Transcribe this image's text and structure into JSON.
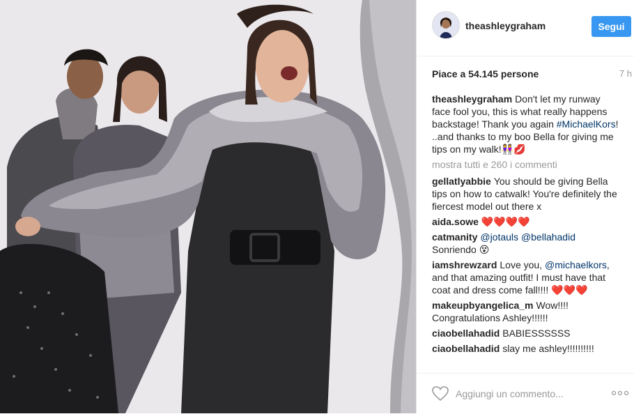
{
  "post": {
    "username": "theashleygraham",
    "follow_label": "Segui",
    "likes": "Piace a 54.145 persone",
    "time": "7 h",
    "caption": {
      "username": "theashleygraham",
      "text_1": "Don't let my runway face fool you, this is what really happens backstage! Thank you again ",
      "hashtag": "#MichaelKors",
      "text_2": "! ..and thanks to my boo Bella for giving me tips on my walk!",
      "emoji": "👭💋"
    },
    "show_all": "mostra tutti e 260 i commenti",
    "add_comment_placeholder": "Aggiungi un commento..."
  },
  "comments": [
    {
      "username": "gellatlyabbie",
      "text": "You should be giving Bella tips on how to catwalk! You're definitely the fiercest model out there x"
    },
    {
      "username": "aida.sowe",
      "text": "❤️❤️❤️❤️"
    },
    {
      "username": "catmanity",
      "mention_1": "@jotauls",
      "mention_2": "@bellahadid",
      "text": "Sonriendo 😵"
    },
    {
      "username": "iamshrewzard",
      "text_1": "Love you, ",
      "mention": "@michaelkors",
      "text_2": ", and that amazing outfit! I must have that coat and dress come fall!!!! ❤️❤️❤️"
    },
    {
      "username": "makeupbyangelica_m",
      "text": "Wow!!!! Congratulations Ashley!!!!!!"
    },
    {
      "username": "ciaobellahadid",
      "text": "BABIESSSSSS"
    },
    {
      "username": "ciaobellahadid",
      "text": "slay me ashley!!!!!!!!!!"
    }
  ],
  "icons": {
    "like": "heart-outline-icon",
    "more": "ellipsis-icon"
  },
  "colors": {
    "follow_button": "#3897f0",
    "mention": "#003569",
    "muted": "#999999"
  }
}
